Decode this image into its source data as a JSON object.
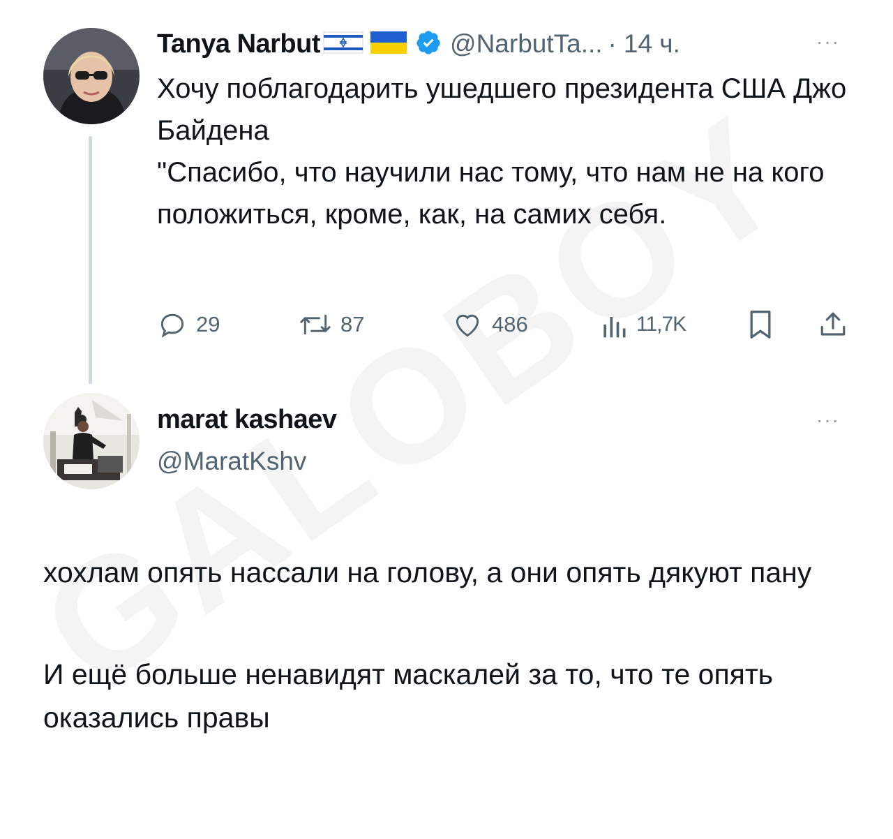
{
  "tweet": {
    "author_name": "Tanya Narbut",
    "author_flags": [
      "israel-flag",
      "ukraine-flag"
    ],
    "verified": true,
    "handle": "@NarbutTa...",
    "separator": "·",
    "time": "14 ч.",
    "more": "···",
    "text_lines": [
      "Хочу поблагодарить ушедшего президента США Джо Байдена",
      "\"Спасибо, что научили нас тому, что нам не на кого положиться, кроме, как, на самих себя."
    ],
    "stats": {
      "replies": "29",
      "retweets": "87",
      "likes": "486",
      "views": "11,7K"
    }
  },
  "reply": {
    "author_name": "marat kashaev",
    "handle": "@MaratKshv",
    "more": "···",
    "text_paragraphs": [
      "хохлам опять нассали на голову, а они опять дякуют пану",
      "И ещё больше ненавидят маскалей за то, что те опять оказались правы"
    ]
  },
  "watermark": "GALOBOY",
  "colors": {
    "text": "#0f1419",
    "secondary": "#536471",
    "verified": "#1d9bf0",
    "thread_line": "#cfd9de"
  },
  "icons": [
    "reply-icon",
    "retweet-icon",
    "like-icon",
    "views-icon",
    "bookmark-icon",
    "share-icon",
    "verified-badge-icon",
    "more-icon"
  ]
}
